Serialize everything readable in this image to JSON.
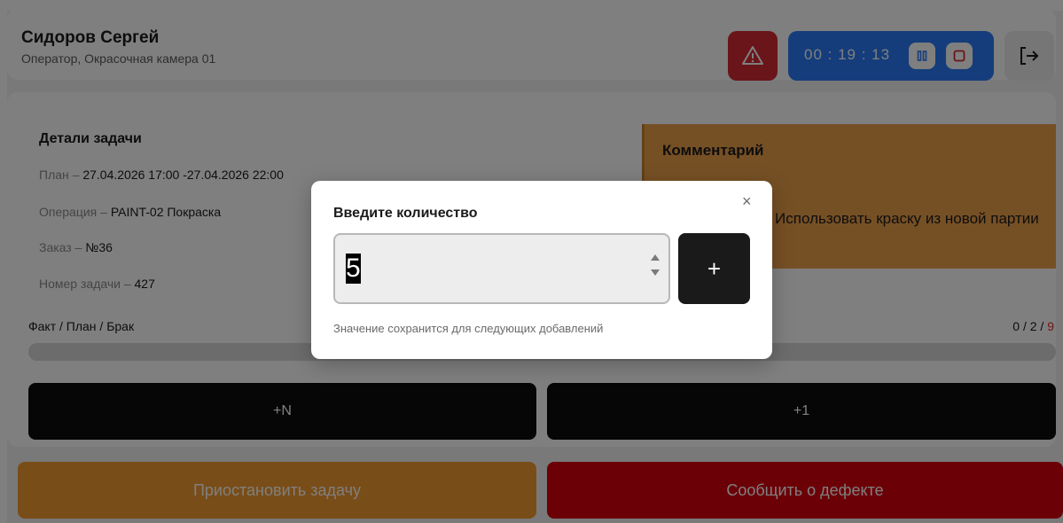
{
  "header": {
    "user_name": "Сидоров Сергей",
    "user_role": "Оператор, Окрасочная камера 01",
    "timer": "00 : 19 : 13"
  },
  "icons": {
    "alert": "warning-triangle-icon",
    "pause": "pause-icon",
    "stop": "stop-icon",
    "logout": "logout-icon",
    "close": "close-icon"
  },
  "task_details": {
    "title": "Детали задачи",
    "plan_label": "План – ",
    "plan_value": "27.04.2026 17:00 -27.04.2026 22:00",
    "operation_label": "Операция – ",
    "operation_value": "PAINT-02 Покраска",
    "order_label": "Заказ – ",
    "order_value": "№36",
    "task_number_label": "Номер задачи – ",
    "task_number_value": "427"
  },
  "comment": {
    "title": "Комментарий",
    "text": "Срочный заказ! Использовать краску из новой партии"
  },
  "progress": {
    "label": "Факт / План / Брак",
    "fact": "0",
    "plan": "2",
    "defect": "9",
    "separator": " / ",
    "fill_fraction": 0
  },
  "buttons": {
    "add_n": "+N",
    "add_one": "+1",
    "pause_task": "Приостановить задачу",
    "report_defect": "Сообщить о дефекте"
  },
  "modal": {
    "title": "Введите количество",
    "close_symbol": "×",
    "quantity_value": "5",
    "add_symbol": "+",
    "hint": "Значение сохранится для следующих добавлений"
  },
  "colors": {
    "alert": "#d52a33",
    "timer": "#2a7af6",
    "pause_task": "#f39a2e",
    "report_defect": "#d9000f",
    "comment_bg": "#eda04a",
    "defect_text": "#e03030"
  }
}
